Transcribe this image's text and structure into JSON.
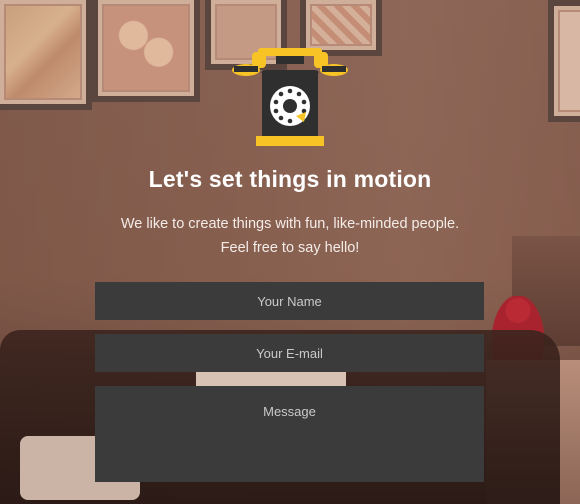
{
  "hero": {
    "headline": "Let's set things in motion",
    "subtext_line1": "We like to create things with fun, like-minded people.",
    "subtext_line2": "Feel free to say hello!"
  },
  "form": {
    "name_placeholder": "Your Name",
    "email_placeholder": "Your E-mail",
    "message_placeholder": "Message"
  },
  "icons": {
    "telephone": "rotary-telephone-icon"
  },
  "colors": {
    "field_background": "#3b3b3b",
    "phone_body": "#2f2f2f",
    "phone_accent": "#f7c325",
    "text": "#ffffff"
  }
}
